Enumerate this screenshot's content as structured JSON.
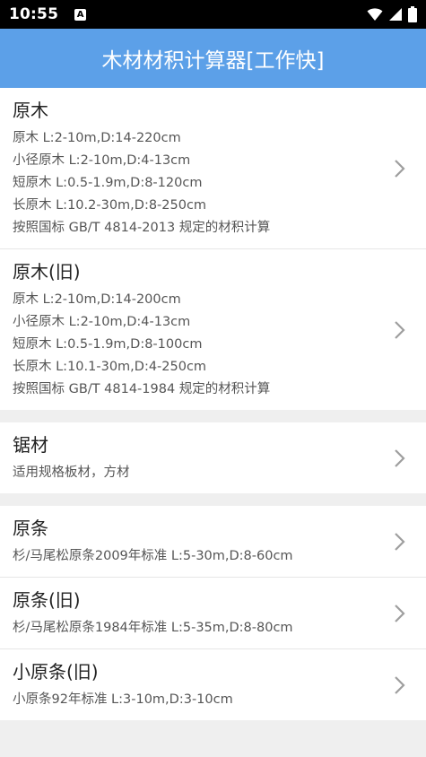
{
  "status_bar": {
    "time": "10:55",
    "notification_icon": "A",
    "icons": [
      "wifi-icon",
      "signal-icon",
      "battery-icon"
    ]
  },
  "app_bar": {
    "title": "木材材积计算器[工作快]"
  },
  "sections": [
    {
      "items": [
        {
          "title": "原木",
          "lines": [
            "原木 L:2-10m,D:14-220cm",
            "小径原木 L:2-10m,D:4-13cm",
            "短原木 L:0.5-1.9m,D:8-120cm",
            "长原木 L:10.2-30m,D:8-250cm",
            "按照国标 GB/T 4814-2013 规定的材积计算"
          ]
        },
        {
          "title": "原木(旧)",
          "lines": [
            "原木 L:2-10m,D:14-200cm",
            "小径原木 L:2-10m,D:4-13cm",
            "短原木 L:0.5-1.9m,D:8-100cm",
            "长原木 L:10.1-30m,D:4-250cm",
            "按照国标 GB/T 4814-1984 规定的材积计算"
          ]
        }
      ]
    },
    {
      "items": [
        {
          "title": "锯材",
          "lines": [
            "适用规格板材，方材"
          ]
        }
      ]
    },
    {
      "items": [
        {
          "title": "原条",
          "lines": [
            "杉/马尾松原条2009年标准 L:5-30m,D:8-60cm"
          ]
        },
        {
          "title": "原条(旧)",
          "lines": [
            "杉/马尾松原条1984年标准 L:5-35m,D:8-80cm"
          ]
        },
        {
          "title": "小原条(旧)",
          "lines": [
            "小原条92年标准 L:3-10m,D:3-10cm"
          ]
        }
      ]
    }
  ],
  "colors": {
    "app_bar": "#5ca0e8",
    "background": "#efefef",
    "chevron": "#9e9e9e"
  }
}
